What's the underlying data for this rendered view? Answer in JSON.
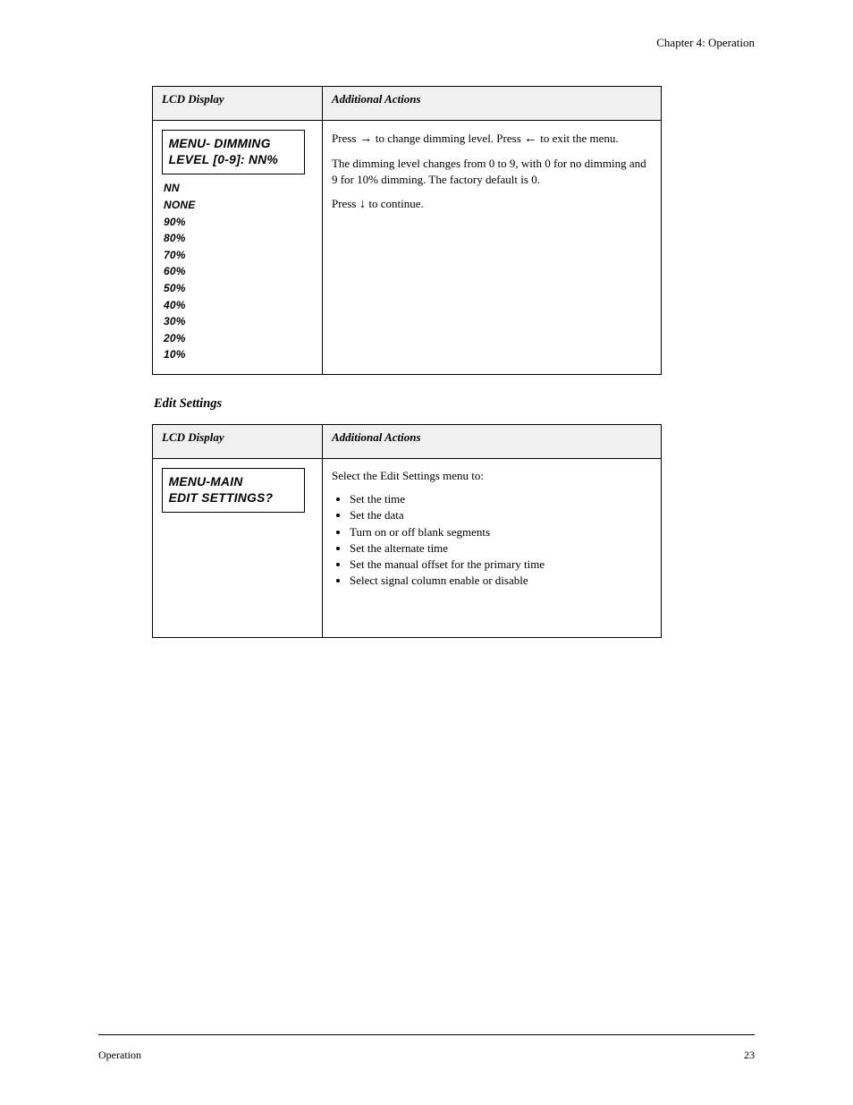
{
  "header_chapter": "Chapter 4: Operation",
  "table1": {
    "head_display": "LCD Display",
    "head_action": "Additional Actions",
    "lcd_line1": "MENU- DIMMING",
    "lcd_line2": "LEVEL [0-9]:  NN%",
    "sub_label": "NN",
    "levels": [
      "NONE",
      "90%",
      "80%",
      "70%",
      "60%",
      "50%",
      "40%",
      "30%",
      "20%",
      "10%"
    ],
    "action_p1_a": "Press ",
    "action_p1_arrow": "→",
    "action_p1_b": " to change dimming level. Press ",
    "action_p1_arrow2": "←",
    "action_p1_c": " to exit the menu.",
    "action_p2_a": "The dimming level changes from 0 to 9, with 0 for no dimming and 9 for 10% dimming. The factory default is 0.",
    "action_p3_a": "Press ",
    "action_p3_arrow": "↓",
    "action_p3_b": " to continue."
  },
  "section_title": "Edit Settings",
  "table2": {
    "head_display": "LCD Display",
    "head_action": "Additional Actions",
    "lcd_line1": "MENU-MAIN",
    "lcd_line2": "EDIT SETTINGS?",
    "action_p1": "Select the Edit Settings menu to:",
    "bullets": [
      "Set the time",
      "Set the data",
      "Turn on or off blank segments",
      "Set the alternate time",
      "Set the manual offset for the primary time",
      "Select signal column enable or disable"
    ]
  },
  "footer_left": "Operation",
  "footer_right": "23"
}
